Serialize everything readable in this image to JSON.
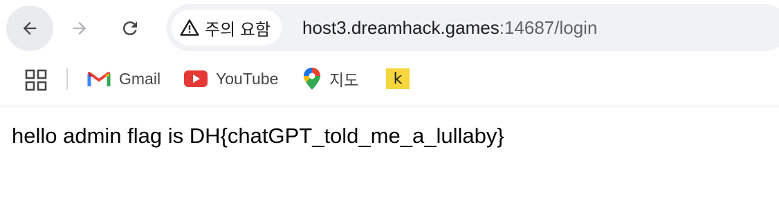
{
  "toolbar": {
    "security_label": "주의 요함",
    "url_host": "host3.dreamhack.games",
    "url_rest": ":14687/login",
    "back_icon": "arrow-left-icon",
    "forward_icon": "arrow-right-icon",
    "reload_icon": "reload-icon",
    "warning_icon": "warning-triangle-icon"
  },
  "bookmarks": {
    "apps_icon": "apps-grid-icon",
    "items": [
      {
        "label": "Gmail",
        "icon": "gmail-icon"
      },
      {
        "label": "YouTube",
        "icon": "youtube-icon"
      },
      {
        "label": "지도",
        "icon": "maps-pin-icon"
      },
      {
        "label": "",
        "icon": "k-icon",
        "icon_text": "k"
      }
    ]
  },
  "page": {
    "message": "hello admin flag is DH{chatGPT_told_me_a_lullaby}"
  },
  "colors": {
    "youtube_red": "#e53935",
    "k_yellow": "#f5d63d",
    "omnibox_bg": "#f0f2f5",
    "active_button_bg": "#e9ebee"
  }
}
